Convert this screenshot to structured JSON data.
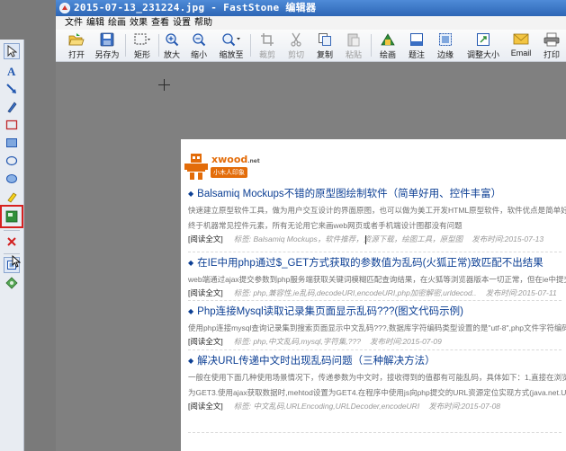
{
  "window": {
    "title": "2015-07-13_231224.jpg - FastStone 编辑器"
  },
  "menu": [
    "文件",
    "编辑",
    "绘画",
    "效果",
    "查看",
    "设置",
    "帮助"
  ],
  "toolbar": {
    "open": "打开",
    "save_as": "另存为",
    "rectangle": "矩形",
    "zoom_in": "放大",
    "zoom_out": "缩小",
    "zoom_to": "缩放至",
    "crop": "裁剪",
    "cut": "剪切",
    "copy": "复制",
    "paste": "粘贴",
    "draw": "绘画",
    "caption": "题注",
    "edge": "边缘",
    "resize": "调整大小",
    "email": "Email",
    "print": "打印"
  },
  "left_tools": [
    {
      "icon": "pointer-arrow-icon"
    },
    {
      "icon": "text-tool-icon"
    },
    {
      "icon": "arrow-tool-icon"
    },
    {
      "icon": "pen-tool-icon"
    },
    {
      "icon": "rectangle-tool-icon"
    },
    {
      "icon": "filled-rectangle-tool-icon"
    },
    {
      "icon": "ellipse-tool-icon"
    },
    {
      "icon": "filled-ellipse-tool-icon"
    },
    {
      "icon": "highlighter-tool-icon"
    },
    {
      "icon": "watermark-tool-icon"
    },
    {
      "icon": "delete-x-icon"
    },
    {
      "icon": "insert-image-icon"
    },
    {
      "icon": "stamp-tool-icon"
    }
  ],
  "site": {
    "brand": "xwood",
    "brand_suffix": ".net",
    "tagline": "小木人印象"
  },
  "articles": [
    {
      "title": "Balsamiq Mockups不错的原型图绘制软件（简单好用、控件丰富）",
      "excerpt1": "快速建立原型软件工具，做为用户交互设计的界面原图，也可以做为美工开发HTML原型软件，软件优点是简单好用、",
      "excerpt2": "终于机器常见控件元素，所有无论用它来画web网页或者手机端设计图都没有问题",
      "read_more": "[阅读全文]",
      "tags": "标签: Balsamiq Mockups，软件推荐，资源下载，绘图工具，原型图",
      "date": "发布时间:2015-07-13"
    },
    {
      "title": "在IE中用php通过$_GET方式获取的参数值为乱码(火狐正常)致匹配不出结果",
      "excerpt1": "web端通过ajax提交参数到php服务端获取关键词模糊匹配查询结果，在火狐等浏览器版本一切正常，但在ie中提交参",
      "read_more": "[阅读全文]",
      "tags": "标签: php,兼容性,ie乱码,decodeURI,encodeURI,php加密解密,urldecod..",
      "date": "发布时间:2015-07-11"
    },
    {
      "title": "Php连接Mysql读取记录集页面显示乱码???(图文代码示例)",
      "excerpt1": "使用php连接mysql查询记录集到搜索页面显示中文乱码???,数据库字符编码类型设置的是\"utf-8\",php文件字符编码件",
      "read_more": "[阅读全文]",
      "tags": "标签: php,中文乱码,mysql,字符集,???",
      "date": "发布时间:2015-07-09"
    },
    {
      "title": "解决URL传递中文时出现乱码问题（三种解决方法）",
      "excerpt1": "一般在使用下面几种使用场景情况下，传递参数为中文时，接收得到的值都有可能乱码，具体如下：1,直接在浏览器的",
      "excerpt2": "为GET3.使用ajax获取数据时,mehtod设置为GET4.在程序中使用js向php提交的URL资源定位实现方式(java.net.UR..",
      "read_more": "[阅读全文]",
      "tags": "标签: 中文乱码,URLEncoding,URLDecoder,encodeURI",
      "date": "发布时间:2015-07-08"
    }
  ],
  "colors": {
    "highlight_box": "#d7201f",
    "title_link": "#0c3f94",
    "brand_orange": "#e36c09"
  }
}
